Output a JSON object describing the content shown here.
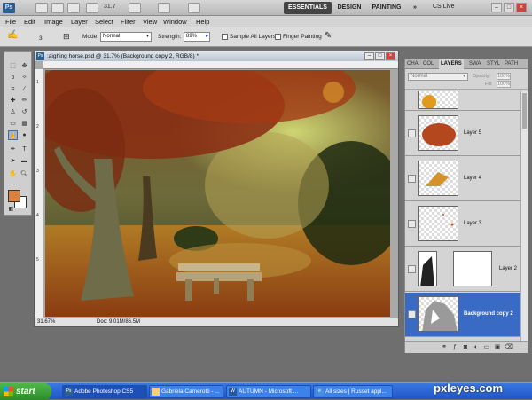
{
  "app": {
    "logo": "Ps",
    "zoom": "31.7",
    "workspaces": [
      "ESSENTIALS",
      "DESIGN",
      "PAINTING"
    ],
    "more": "»",
    "cs_live": "CS Live",
    "win_min": "–",
    "win_max": "□",
    "win_close": "×"
  },
  "menu": [
    "File",
    "Edit",
    "Image",
    "Layer",
    "Select",
    "Filter",
    "View",
    "Window",
    "Help"
  ],
  "options": {
    "brush_size": "3",
    "mode_label": "Mode:",
    "mode_value": "Normal",
    "strength_label": "Strength:",
    "strength_value": "89%",
    "sample_all_layers": "Sample All Layers",
    "finger_painting": "Finger Painting"
  },
  "document": {
    "title": ":aighing horse.psd @ 31.7% (Background copy 2, RGB/8) *",
    "zoom": "31.67%",
    "doc_info": "Doc: 9.01M/86.5M",
    "ruler_left": [
      "1",
      "2",
      "3",
      "4",
      "5"
    ]
  },
  "panel": {
    "tabs": [
      "CHAI",
      "COL",
      "LAYERS",
      "SWA",
      "STYL",
      "PATH"
    ],
    "blend_mode": "Normal",
    "opacity_label": "Opacity:",
    "opacity_value": "100%",
    "fill_label": "Fill:",
    "fill_value": "100%",
    "layers": [
      "",
      "Layer 5",
      "Layer 4",
      "Layer 3",
      "Layer 2",
      "Background copy 2"
    ]
  },
  "taskbar": {
    "start": "start",
    "items": [
      "Adobe Photoshop CS5",
      "Gabriela Camerotti - ...",
      "AUTUMN - Microsoft ...",
      "All sizes | Russet appl..."
    ]
  },
  "watermark": "pxleyes.com",
  "colors": {
    "accent": "#3a6bc4",
    "foreground_swatch": "#d9823f",
    "taskbar": "#2a63d4"
  }
}
